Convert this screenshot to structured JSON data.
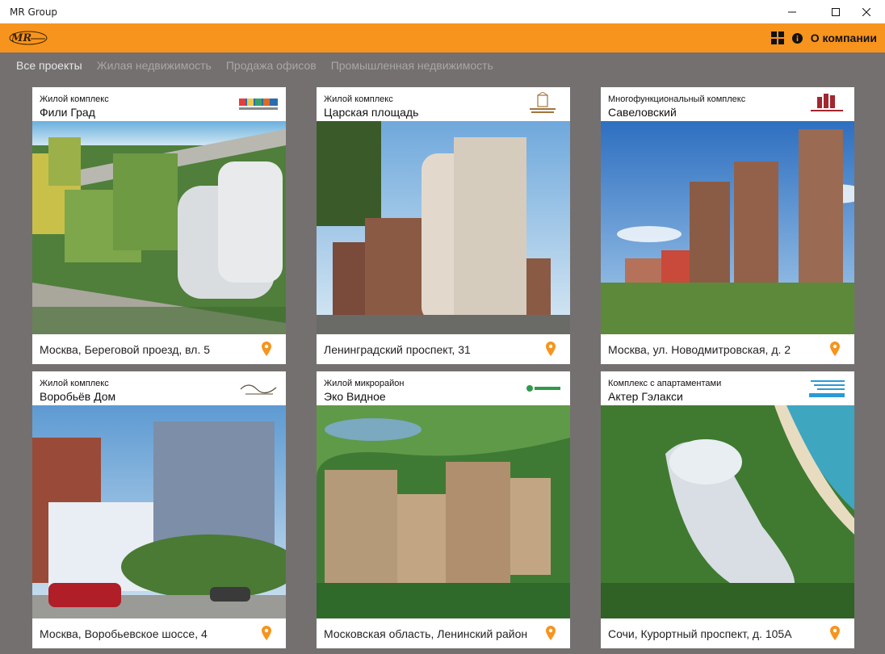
{
  "window": {
    "title": "MR Group"
  },
  "appbar": {
    "about_label": "О компании",
    "accent": "#f7941d"
  },
  "tabs": [
    {
      "label": "Все проекты",
      "active": true
    },
    {
      "label": "Жилая недвижимость",
      "active": false
    },
    {
      "label": "Продажа офисов",
      "active": false
    },
    {
      "label": "Промышленная недвижимость",
      "active": false
    }
  ],
  "projects": [
    {
      "category": "Жилой комплекс",
      "name": "Фили Град",
      "address": "Москва, Береговой проезд, вл. 5",
      "logo_icon": "fili-grad-logo",
      "image": "fili-grad-photo"
    },
    {
      "category": "Жилой комплекс",
      "name": "Царская площадь",
      "address": "Ленинградский проспект, 31",
      "logo_icon": "tsarskaya-ploshchad-logo",
      "image": "tsarskaya-ploshchad-photo"
    },
    {
      "category": "Многофункциональный комплекс",
      "name": "Савеловский",
      "address": "Москва, ул. Новодмитровская, д. 2",
      "logo_icon": "savelovsky-logo",
      "image": "savelovsky-photo"
    },
    {
      "category": "Жилой комплекс",
      "name": "Воробьёв Дом",
      "address": "Москва, Воробьевское шоссе, 4",
      "logo_icon": "vorobyov-dom-logo",
      "image": "vorobyov-dom-photo"
    },
    {
      "category": "Жилой микрорайон",
      "name": "Эко Видное",
      "address": "Московская область, Ленинский район",
      "logo_icon": "eko-vidnoe-logo",
      "image": "eko-vidnoe-photo"
    },
    {
      "category": "Комплекс с апартаментами",
      "name": "Актер Гэлакси",
      "address": "Сочи, Курортный проспект, д. 105А",
      "logo_icon": "akter-galaxy-logo",
      "image": "akter-galaxy-photo"
    }
  ]
}
